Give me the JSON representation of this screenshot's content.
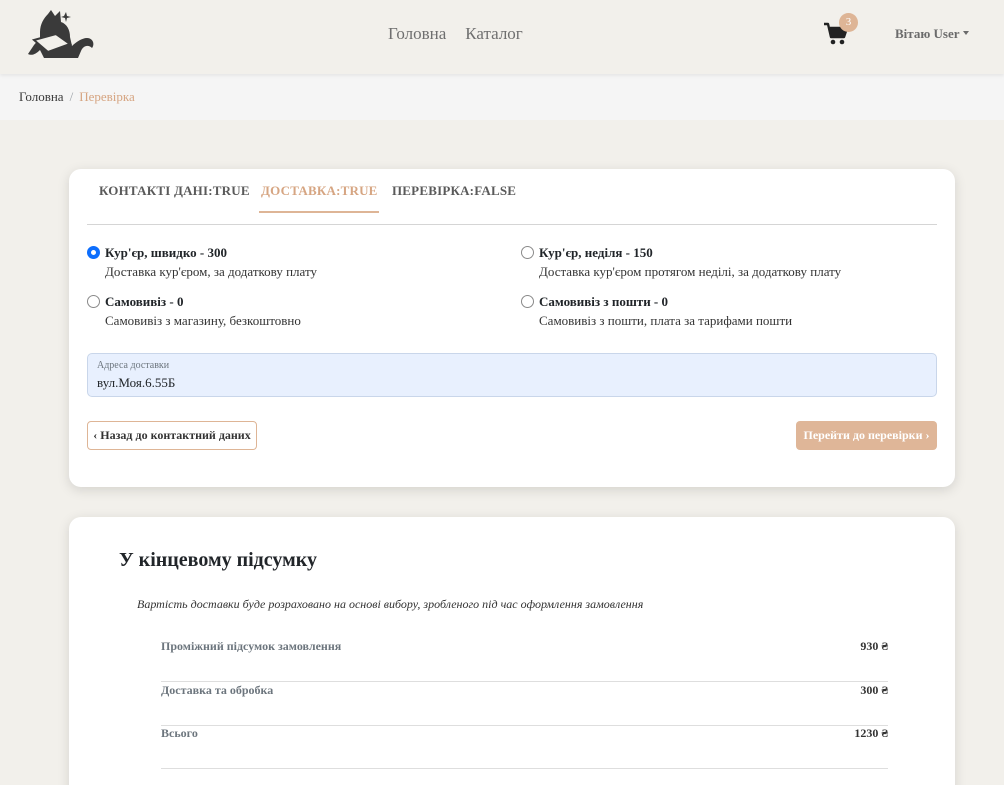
{
  "navbar": {
    "links": [
      "Головна",
      "Каталог"
    ],
    "cart_count": "3",
    "user_label": "Вітаю User"
  },
  "breadcrumb": {
    "home": "Головна",
    "separator": "/",
    "current": "Перевірка"
  },
  "checkout": {
    "tabs": [
      {
        "label": "КОНТАКТІ ДАНІ:TRUE",
        "active": false
      },
      {
        "label": "ДОСТАВКА:TRUE",
        "active": true
      },
      {
        "label": "ПЕРЕВІРКА:FALSE",
        "active": false
      }
    ],
    "delivery_options": [
      {
        "title": "Кур'єр, швидко - 300",
        "description": "Доставка кур'єром, за додаткову плату",
        "selected": true
      },
      {
        "title": "Кур'єр, неділя - 150",
        "description": "Доставка кур'єром протягом неділі, за додаткову плату",
        "selected": false
      },
      {
        "title": "Самовивіз - 0",
        "description": "Самовивіз з магазину, безкоштовно",
        "selected": false
      },
      {
        "title": "Самовивіз з пошти - 0",
        "description": "Самовивіз з пошти, плата за тарифами пошти",
        "selected": false
      }
    ],
    "address": {
      "label": "Адреса доставки",
      "value": "вул.Моя.6.55Б"
    },
    "back_button": "Назад до контактний даних",
    "next_button": "Перейти до перевірки"
  },
  "summary": {
    "title": "У кінцевому підсумку",
    "note": "Вартість доставки буде розраховано на основі вибору, зробленого під час оформлення замовлення",
    "rows": [
      {
        "label": "Проміжний підсумок замовлення",
        "value": "930 ₴"
      },
      {
        "label": "Доставка та обробка",
        "value": "300 ₴"
      },
      {
        "label": "Всього",
        "value": "1230 ₴"
      }
    ]
  },
  "colors": {
    "accent": "#deb596",
    "accent_text": "#d6a582",
    "radio_checked": "#0d6efd",
    "background": "#f2f0eb"
  },
  "icons": [
    "cat-logo-icon",
    "cart-icon",
    "caret-down-icon",
    "chevron-left-icon",
    "chevron-right-icon"
  ]
}
